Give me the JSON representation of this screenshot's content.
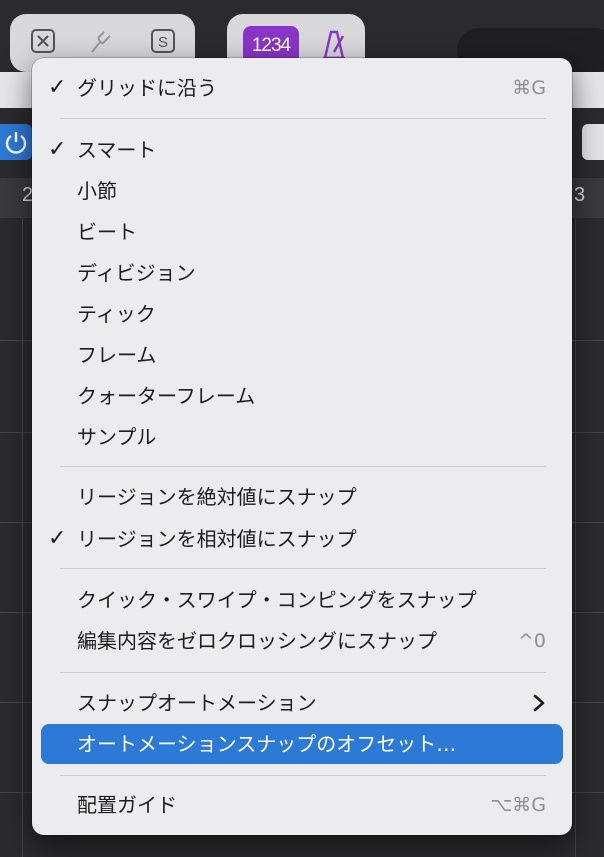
{
  "background": {
    "count_in_label": "1234",
    "ruler_numbers": [
      "2",
      "3"
    ],
    "toolbar_icons": [
      "x-box-icon",
      "tuning-fork-icon",
      "s-box-icon",
      "metronome-icon"
    ],
    "accent_color": "#2d79d6",
    "count_in_color": "#8a35c9"
  },
  "menu": {
    "items": [
      {
        "label": "グリッドに沿う",
        "checked": true,
        "shortcut": "⌘G"
      },
      {
        "label": "スマート",
        "checked": true
      },
      {
        "label": "小節",
        "checked": false
      },
      {
        "label": "ビート",
        "checked": false
      },
      {
        "label": "ディビジョン",
        "checked": false
      },
      {
        "label": "ティック",
        "checked": false
      },
      {
        "label": "フレーム",
        "checked": false
      },
      {
        "label": "クォーターフレーム",
        "checked": false
      },
      {
        "label": "サンプル",
        "checked": false
      },
      {
        "label": "リージョンを絶対値にスナップ",
        "checked": false
      },
      {
        "label": "リージョンを相対値にスナップ",
        "checked": true
      },
      {
        "label": "クイック・スワイプ・コンピングをスナップ",
        "checked": false
      },
      {
        "label": "編集内容をゼロクロッシングにスナップ",
        "checked": false,
        "shortcut": "^0"
      },
      {
        "label": "スナップオートメーション",
        "checked": false,
        "submenu": true
      },
      {
        "label": "オートメーションスナップのオフセット…",
        "checked": false,
        "highlighted": true
      },
      {
        "label": "配置ガイド",
        "checked": false,
        "shortcut": "⌥⌘G"
      }
    ],
    "check_glyph": "✓"
  }
}
